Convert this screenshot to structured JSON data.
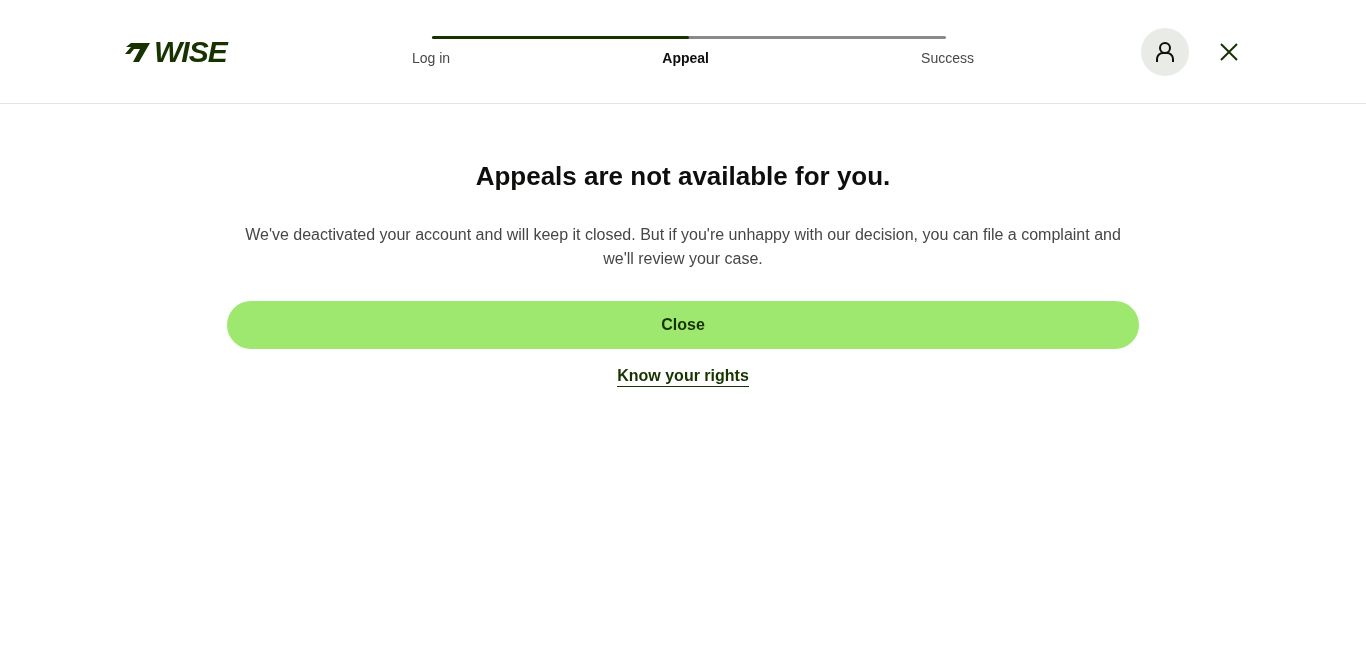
{
  "header": {
    "logo": "WISE",
    "progress": {
      "level": 0.5
    },
    "steps": [
      {
        "label": "Log in",
        "selected": false
      },
      {
        "label": "Appeal",
        "selected": true
      },
      {
        "label": "Success",
        "selected": false
      }
    ]
  },
  "main": {
    "title": "Appeals are not available for you.",
    "message": "We've deactivated your account and will keep it closed. But if you're unhappy with our decision, you can file a complaint and we'll review your case.",
    "button": "Close",
    "link": "Know your rights"
  }
}
